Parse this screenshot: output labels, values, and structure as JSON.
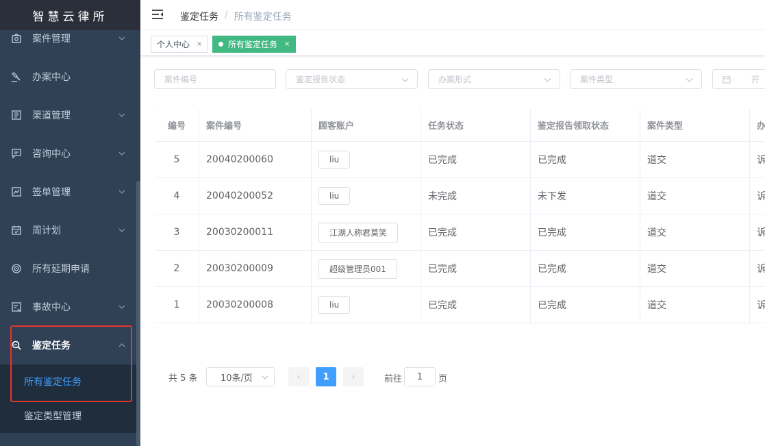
{
  "app": {
    "title": "智慧云律所"
  },
  "sidebar": {
    "items": [
      {
        "label": "案件管理",
        "icon": "case-icon"
      },
      {
        "label": "办案中心",
        "icon": "gavel-icon"
      },
      {
        "label": "渠道管理",
        "icon": "channel-icon"
      },
      {
        "label": "咨询中心",
        "icon": "message-icon"
      },
      {
        "label": "签单管理",
        "icon": "contract-icon"
      },
      {
        "label": "周计划",
        "icon": "calendar-icon"
      },
      {
        "label": "所有延期申请",
        "icon": "target-icon"
      },
      {
        "label": "事故中心",
        "icon": "incident-icon"
      },
      {
        "label": "鉴定任务",
        "icon": "search-doc-icon"
      }
    ],
    "submenu": [
      {
        "label": "所有鉴定任务"
      },
      {
        "label": "鉴定类型管理"
      }
    ]
  },
  "header": {
    "breadcrumb": [
      "鉴定任务",
      "所有鉴定任务"
    ],
    "breadcrumb_sep": "/"
  },
  "tags": [
    {
      "label": "个人中心",
      "close": "×"
    },
    {
      "label": "所有鉴定任务",
      "close": "×"
    }
  ],
  "filters": {
    "case_no": "案件编号",
    "report_status": "鉴定报告状态",
    "handling_form": "办案形式",
    "case_type": "案件类型",
    "date_start": "开"
  },
  "table": {
    "columns": [
      "编号",
      "案件编号",
      "顾客账户",
      "任务状态",
      "鉴定报告领取状态",
      "案件类型",
      "办"
    ],
    "rows": [
      {
        "id": "5",
        "case_no": "20040200060",
        "account": "liu",
        "task_status": "已完成",
        "report_status": "已完成",
        "case_type": "道交",
        "form": "诉"
      },
      {
        "id": "4",
        "case_no": "20040200052",
        "account": "liu",
        "task_status": "未完成",
        "report_status": "未下发",
        "case_type": "道交",
        "form": "诉"
      },
      {
        "id": "3",
        "case_no": "20030200011",
        "account": "江湖人称君莫笑",
        "task_status": "已完成",
        "report_status": "已完成",
        "case_type": "道交",
        "form": "诉"
      },
      {
        "id": "2",
        "case_no": "20030200009",
        "account": "超级管理员001",
        "task_status": "已完成",
        "report_status": "已完成",
        "case_type": "道交",
        "form": "诉"
      },
      {
        "id": "1",
        "case_no": "20030200008",
        "account": "liu",
        "task_status": "已完成",
        "report_status": "已完成",
        "case_type": "道交",
        "form": "诉"
      }
    ]
  },
  "pagination": {
    "total": "共 5 条",
    "page_size": "10条/页",
    "prev": "‹",
    "current_page": "1",
    "next": "›",
    "goto_label": "前往",
    "goto_value": "1",
    "page_suffix": "页"
  },
  "colors": {
    "sidebar_bg": "#304156",
    "accent": "#409eff",
    "tag_active": "#42b983",
    "highlight": "#e8342a"
  }
}
